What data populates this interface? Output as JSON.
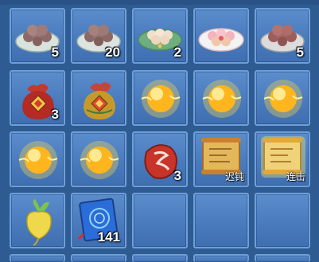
{
  "inventory": {
    "items": [
      {
        "name": "plate-of-rice-balls-brown",
        "icon": "plate-brown-balls-icon",
        "count": "5"
      },
      {
        "name": "plate-of-rice-balls-dark",
        "icon": "plate-dark-balls-icon",
        "count": "20"
      },
      {
        "name": "plate-of-dumplings-light",
        "icon": "plate-light-dumplings-icon",
        "count": "2"
      },
      {
        "name": "plate-of-pink-dumplings",
        "icon": "plate-pink-dumplings-icon",
        "count": ""
      },
      {
        "name": "plate-of-red-bean-balls",
        "icon": "plate-red-balls-icon",
        "count": "5"
      },
      {
        "name": "lucky-pouch-red",
        "icon": "red-pouch-icon",
        "count": "3"
      },
      {
        "name": "lucky-pouch-gold",
        "icon": "gold-pouch-icon",
        "count": ""
      },
      {
        "name": "glowing-orb-1",
        "icon": "golden-orb-icon",
        "count": ""
      },
      {
        "name": "glowing-orb-2",
        "icon": "golden-orb-icon",
        "count": ""
      },
      {
        "name": "glowing-orb-3",
        "icon": "golden-orb-icon",
        "count": ""
      },
      {
        "name": "glowing-orb-4",
        "icon": "golden-orb-icon",
        "count": ""
      },
      {
        "name": "glowing-orb-5",
        "icon": "golden-orb-icon",
        "count": ""
      },
      {
        "name": "red-rune-stone",
        "icon": "red-rune-stone-icon",
        "count": "3"
      },
      {
        "name": "skill-scroll-slow",
        "icon": "scroll-icon",
        "count": "",
        "tag": "迟钝"
      },
      {
        "name": "skill-scroll-combo",
        "icon": "glowing-scroll-icon",
        "count": "",
        "tag": "连击"
      },
      {
        "name": "golden-radish",
        "icon": "golden-radish-icon",
        "count": ""
      },
      {
        "name": "blue-spellbook",
        "icon": "blue-book-icon",
        "count": "141"
      },
      {
        "name": "empty-slot",
        "icon": "",
        "count": ""
      },
      {
        "name": "empty-slot",
        "icon": "",
        "count": ""
      },
      {
        "name": "empty-slot",
        "icon": "",
        "count": ""
      }
    ]
  },
  "colors": {
    "background": "#2f5b93",
    "slot_fill": "#4a7bbd",
    "slot_border": "#6f9fd8",
    "orb": "#ffcc22"
  }
}
